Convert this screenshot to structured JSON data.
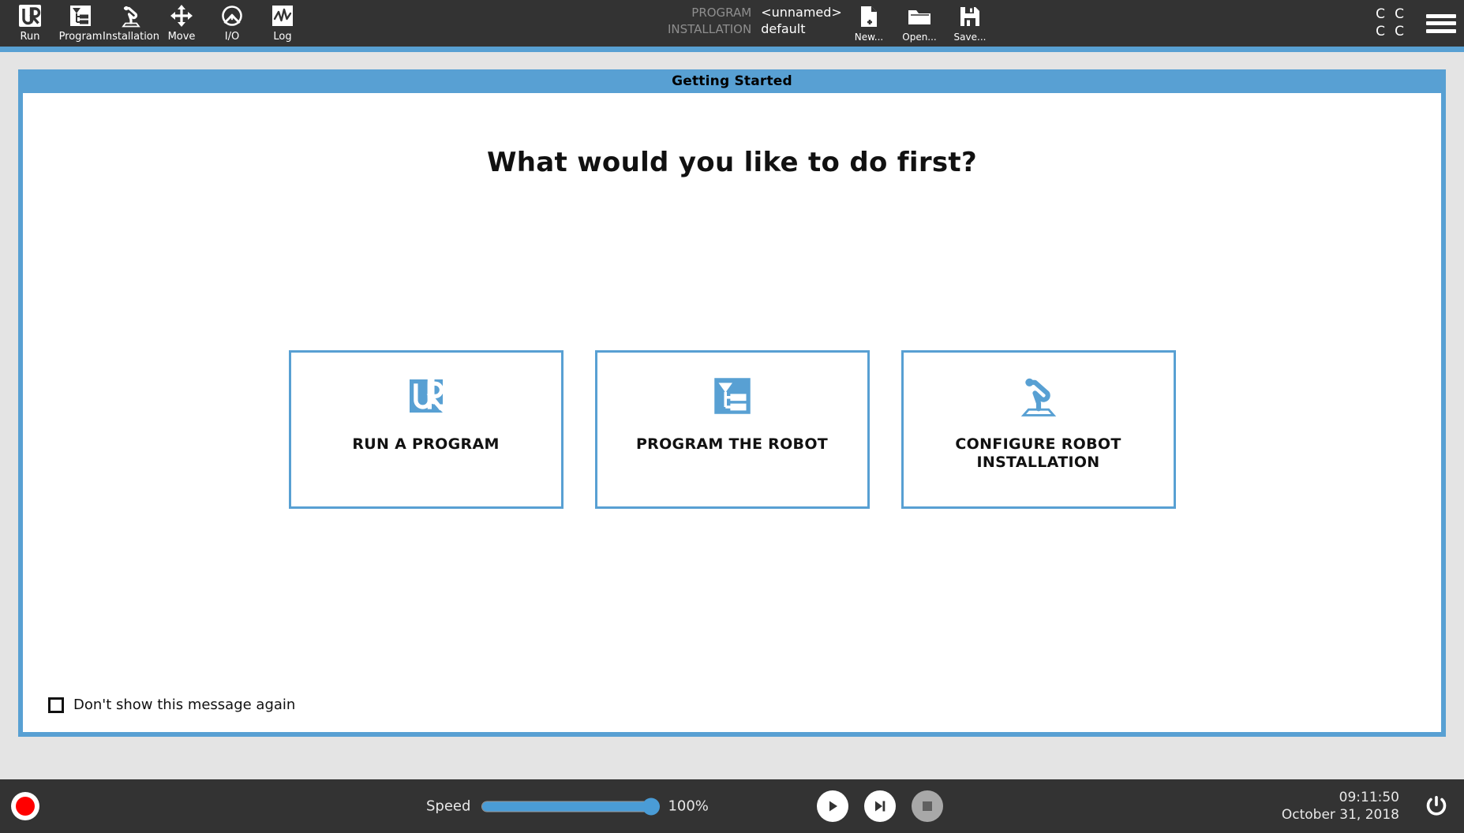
{
  "header": {
    "toolbar": [
      {
        "id": "run",
        "label": "Run",
        "icon": "ur-logo-icon"
      },
      {
        "id": "program",
        "label": "Program",
        "icon": "program-tree-icon"
      },
      {
        "id": "installation",
        "label": "Installation",
        "icon": "robot-arm-icon"
      },
      {
        "id": "move",
        "label": "Move",
        "icon": "move-arrows-icon"
      },
      {
        "id": "io",
        "label": "I/O",
        "icon": "io-gauge-icon"
      },
      {
        "id": "log",
        "label": "Log",
        "icon": "log-graph-icon"
      }
    ],
    "program_info": [
      {
        "key": "PROGRAM",
        "value": "<unnamed>"
      },
      {
        "key": "INSTALLATION",
        "value": "default"
      }
    ],
    "file_ops": [
      {
        "id": "new",
        "label": "New...",
        "icon": "new-file-icon"
      },
      {
        "id": "open",
        "label": "Open...",
        "icon": "open-folder-icon"
      },
      {
        "id": "save",
        "label": "Save...",
        "icon": "save-floppy-icon"
      }
    ],
    "status_glyphs": [
      "C",
      "C",
      "C",
      "C"
    ],
    "menu_label": "hamburger-menu-icon"
  },
  "dialog": {
    "title": "Getting Started",
    "headline": "What would you like to do first?",
    "cards": [
      {
        "id": "run-a-program",
        "label": "RUN A PROGRAM",
        "icon": "ur-logo-icon"
      },
      {
        "id": "program-the-robot",
        "label": "PROGRAM THE ROBOT",
        "icon": "program-tree-icon"
      },
      {
        "id": "configure-robot",
        "label": "CONFIGURE ROBOT INSTALLATION",
        "icon": "robot-arm-icon"
      }
    ],
    "dont_show_label": "Don't show this message again",
    "dont_show_checked": false
  },
  "footer": {
    "robot_state": "stopped",
    "speed_label": "Speed",
    "speed_value": "100%",
    "speed_percent": 100,
    "transport": [
      {
        "id": "play",
        "label": "play-icon",
        "enabled": true
      },
      {
        "id": "step",
        "label": "step-icon",
        "enabled": true
      },
      {
        "id": "stop",
        "label": "stop-icon",
        "enabled": false
      }
    ],
    "time": "09:11:50",
    "date": "October 31, 2018",
    "power_label": "power-icon"
  },
  "colors": {
    "accent_blue": "#58a0d3",
    "header_dark": "#333333",
    "body_grey": "#e4e4e4",
    "state_red": "#ff0000",
    "slider_blue": "#4a9cd6"
  }
}
